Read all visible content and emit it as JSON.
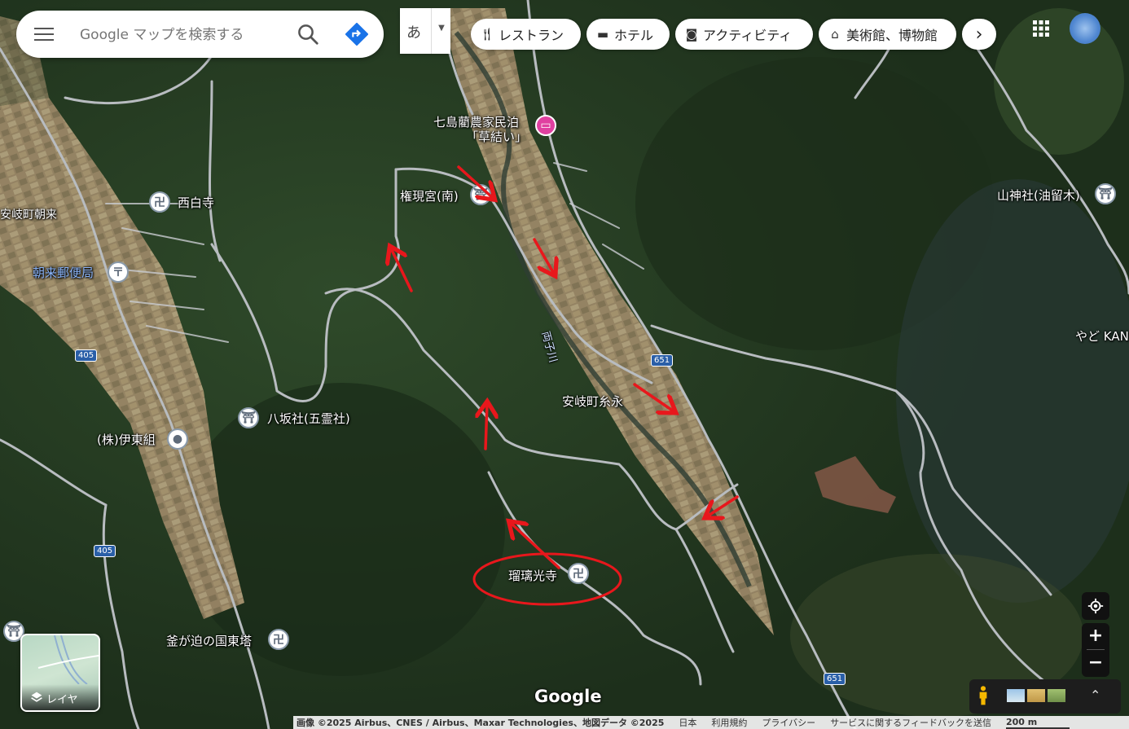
{
  "search": {
    "placeholder": "Google マップを検索する",
    "ime_char": "あ"
  },
  "icons": {
    "menu": "menu-icon",
    "search": "search-icon",
    "directions": "directions-icon",
    "apps": "apps-grid-icon",
    "layers": "layers-icon",
    "pegman": "pegman-icon",
    "location": "my-location-icon"
  },
  "chips": [
    {
      "label": "レストラン",
      "icon": "fork-knife-icon"
    },
    {
      "label": "ホテル",
      "icon": "bed-icon"
    },
    {
      "label": "アクティビティ",
      "icon": "camera-icon"
    },
    {
      "label": "美術館、博物館",
      "icon": "museum-icon"
    }
  ],
  "places": {
    "nanashima": "七島藺農家民泊",
    "nanashima2": "「草結い」",
    "gongen": "権現宮(南)",
    "saihakuji": "西白寺",
    "aki_asaku": "安岐町朝来",
    "post_office": "朝来郵便局",
    "yasaka": "八坂社(五霊社)",
    "itogumi": "(株)伊東組",
    "itonaga": "安岐町糸永",
    "rurikoji": "瑠璃光寺",
    "kamagasako": "釜が迫の国東塔",
    "yamagami": "山神社(油留木)",
    "yado": "やど KAN",
    "river": "両子川"
  },
  "routes": {
    "r405a": "405",
    "r405b": "405",
    "r651a": "651",
    "r651b": "651"
  },
  "controls": {
    "zoom_in": "+",
    "zoom_out": "−",
    "layers_label": "レイヤ",
    "more": "›",
    "collapse": "⌃"
  },
  "google_logo": "Google",
  "footer": {
    "imagery": "画像 ©2025 Airbus、CNES / Airbus、Maxar Technologies、地図データ ©2025",
    "japan": "日本",
    "terms": "利用規約",
    "privacy": "プライバシー",
    "feedback": "サービスに関するフィードバックを送信",
    "scale": "200 m"
  },
  "colors": {
    "annotation": "#e8171c",
    "road": "#b8bcc0",
    "pin_pink": "#e040a0",
    "route_shield": "#2a5fa8"
  }
}
